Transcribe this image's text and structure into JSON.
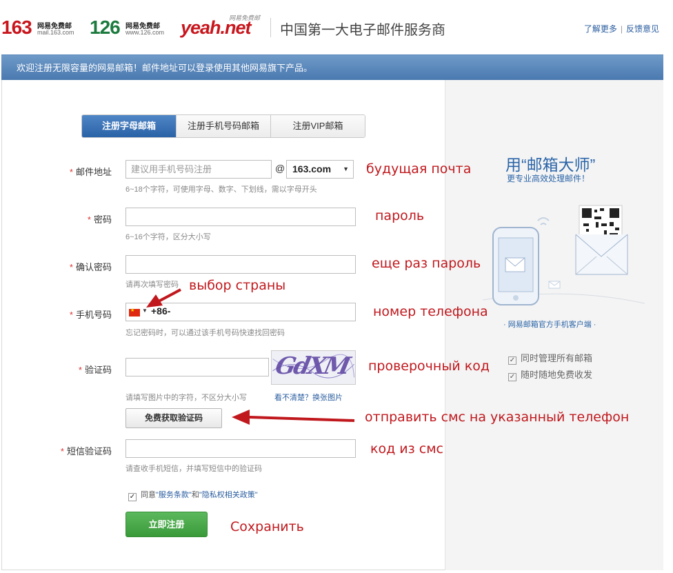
{
  "header": {
    "logo163": {
      "number": "163",
      "line1": "网易免费邮",
      "line2": "mail.163.com"
    },
    "logo126": {
      "number": "126",
      "line1": "网易免费邮",
      "line2": "www.126.com"
    },
    "logoyeah": {
      "text": "yeah.net",
      "tag": "网易免费邮"
    },
    "slogan": "中国第一大电子邮件服务商",
    "links": [
      "了解更多",
      "反馈意见"
    ]
  },
  "banner": {
    "text": "欢迎注册无限容量的网易邮箱！邮件地址可以登录使用其他网易旗下产品。"
  },
  "tabs": [
    {
      "label": "注册字母邮箱",
      "active": true
    },
    {
      "label": "注册手机号码邮箱",
      "active": false
    },
    {
      "label": "注册VIP邮箱",
      "active": false
    }
  ],
  "form": {
    "email": {
      "label": "邮件地址",
      "placeholder": "建议用手机号码注册",
      "at": "@",
      "domain": "163.com",
      "hint": "6~18个字符，可使用字母、数字、下划线，需以字母开头"
    },
    "password": {
      "label": "密码",
      "hint": "6~16个字符，区分大小写"
    },
    "confirm": {
      "label": "确认密码",
      "hint": "请再次填写密码"
    },
    "phone": {
      "label": "手机号码",
      "code": "+86-",
      "hint": "忘记密码时，可以通过该手机号码快速找回密码"
    },
    "captcha": {
      "label": "验证码",
      "hint": "请填写图片中的字符，不区分大小写",
      "image_text": "GdXM",
      "refresh": "看不清楚？换张图片"
    },
    "sms_button": "免费获取验证码",
    "sms": {
      "label": "短信验证码",
      "hint": "请查收手机短信，并填写短信中的验证码"
    },
    "agree": {
      "prefix": "同意",
      "terms": "\"服务条款\"",
      "and": "和",
      "privacy": "\"隐私权相关政策\"",
      "checked": true
    },
    "submit": "立即注册",
    "required_mark": "*"
  },
  "annotations": {
    "email": "будущая почта",
    "password": "пароль",
    "confirm": "еще раз пароль",
    "country": "выбор страны",
    "phone": "номер телефона",
    "captcha": "проверочный код",
    "sms": "отправить смс на указанный телефон",
    "sms_code": "код из смс",
    "save": "Сохранить"
  },
  "side": {
    "title": "用“邮箱大师”",
    "subtitle": "更专业高效处理邮件！",
    "client": "· 网易邮箱官方手机客户端 ·",
    "features": [
      "同时管理所有邮箱",
      "随时随地免费收发"
    ]
  },
  "colors": {
    "banner": "#5b88bf",
    "annotation": "#c0181d",
    "submit": "#49a949",
    "tab_active": "#3a72b6"
  }
}
